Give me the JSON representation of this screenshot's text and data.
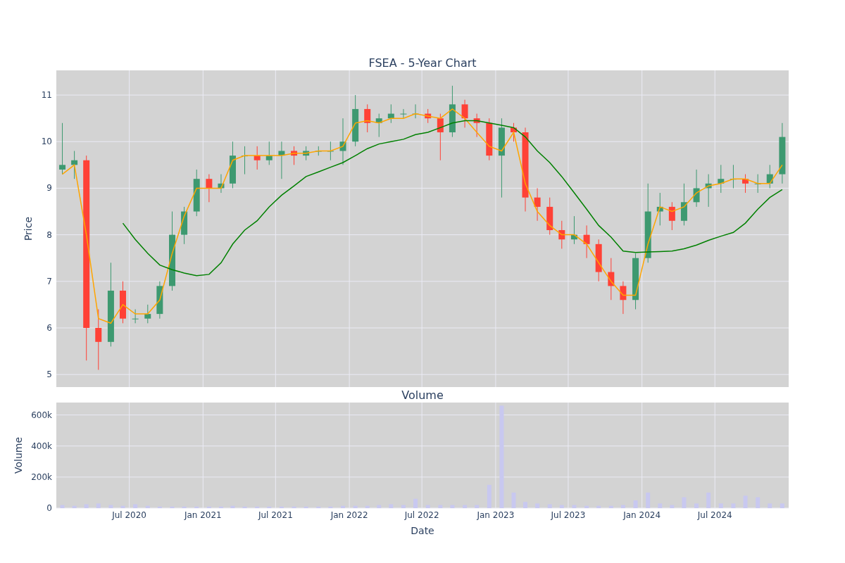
{
  "price_chart": {
    "chart_data": {
      "type": "candlestick",
      "title": "FSEA - 5-Year Chart",
      "grid": true,
      "ohlc": [
        [
          9.4,
          10.4,
          9.3,
          9.5
        ],
        [
          9.5,
          9.8,
          9.2,
          9.6
        ],
        [
          9.6,
          9.7,
          5.3,
          6.0
        ],
        [
          6.0,
          6.4,
          5.1,
          5.7
        ],
        [
          5.7,
          7.4,
          5.6,
          6.8
        ],
        [
          6.8,
          7.0,
          6.1,
          6.2
        ],
        [
          6.2,
          6.4,
          6.1,
          6.2
        ],
        [
          6.2,
          6.5,
          6.1,
          6.3
        ],
        [
          6.3,
          7.0,
          6.2,
          6.9
        ],
        [
          6.9,
          8.5,
          6.8,
          8.0
        ],
        [
          8.0,
          8.6,
          7.8,
          8.5
        ],
        [
          8.5,
          9.4,
          8.4,
          9.2
        ],
        [
          9.2,
          9.3,
          8.7,
          9.0
        ],
        [
          9.0,
          9.3,
          8.9,
          9.1
        ],
        [
          9.1,
          10.0,
          9.0,
          9.7
        ],
        [
          9.7,
          9.9,
          9.3,
          9.7
        ],
        [
          9.7,
          9.9,
          9.4,
          9.6
        ],
        [
          9.6,
          10.0,
          9.5,
          9.7
        ],
        [
          9.7,
          10.0,
          9.2,
          9.8
        ],
        [
          9.8,
          9.9,
          9.5,
          9.7
        ],
        [
          9.7,
          9.9,
          9.6,
          9.8
        ],
        [
          9.8,
          9.9,
          9.7,
          9.8
        ],
        [
          9.8,
          10.0,
          9.6,
          9.8
        ],
        [
          9.8,
          10.5,
          9.5,
          10.0
        ],
        [
          10.0,
          11.0,
          9.9,
          10.7
        ],
        [
          10.7,
          10.8,
          10.2,
          10.4
        ],
        [
          10.4,
          10.6,
          10.1,
          10.5
        ],
        [
          10.5,
          10.8,
          10.4,
          10.6
        ],
        [
          10.6,
          10.7,
          10.5,
          10.6
        ],
        [
          10.6,
          10.8,
          10.5,
          10.6
        ],
        [
          10.6,
          10.7,
          10.4,
          10.5
        ],
        [
          10.5,
          10.6,
          9.6,
          10.2
        ],
        [
          10.2,
          11.2,
          10.1,
          10.8
        ],
        [
          10.8,
          10.9,
          10.3,
          10.5
        ],
        [
          10.5,
          10.6,
          10.1,
          10.4
        ],
        [
          10.4,
          10.5,
          9.6,
          9.7
        ],
        [
          9.7,
          10.5,
          8.8,
          10.3
        ],
        [
          10.3,
          10.4,
          10.0,
          10.2
        ],
        [
          10.2,
          10.3,
          8.5,
          8.8
        ],
        [
          8.8,
          9.0,
          8.3,
          8.6
        ],
        [
          8.6,
          8.8,
          8.0,
          8.1
        ],
        [
          8.1,
          8.3,
          7.7,
          7.9
        ],
        [
          7.9,
          8.4,
          7.8,
          8.0
        ],
        [
          8.0,
          8.2,
          7.5,
          7.8
        ],
        [
          7.8,
          7.9,
          7.0,
          7.2
        ],
        [
          7.2,
          7.5,
          6.6,
          6.9
        ],
        [
          6.9,
          7.0,
          6.3,
          6.6
        ],
        [
          6.6,
          7.6,
          6.4,
          7.5
        ],
        [
          7.5,
          9.1,
          7.4,
          8.5
        ],
        [
          8.5,
          8.9,
          8.2,
          8.6
        ],
        [
          8.6,
          8.7,
          8.1,
          8.3
        ],
        [
          8.3,
          9.1,
          8.2,
          8.7
        ],
        [
          8.7,
          9.4,
          8.6,
          9.0
        ],
        [
          9.0,
          9.3,
          8.6,
          9.1
        ],
        [
          9.1,
          9.5,
          8.9,
          9.2
        ],
        [
          9.2,
          9.5,
          9.0,
          9.2
        ],
        [
          9.2,
          9.3,
          8.9,
          9.1
        ],
        [
          9.1,
          9.3,
          8.9,
          9.1
        ],
        [
          9.1,
          9.5,
          9.0,
          9.3
        ],
        [
          9.3,
          10.4,
          9.1,
          10.1
        ]
      ],
      "ylabel": "Price",
      "ylim": [
        4.73,
        11.53
      ],
      "xlim": [
        "2020-01-01",
        "2025-01-01"
      ],
      "yticks": [
        {
          "value": 5,
          "label": "5"
        },
        {
          "value": 6,
          "label": "6"
        },
        {
          "value": 7,
          "label": "7"
        },
        {
          "value": 8,
          "label": "8"
        },
        {
          "value": 9,
          "label": "9"
        },
        {
          "value": 10,
          "label": "10"
        },
        {
          "value": 11,
          "label": "11"
        }
      ],
      "x": [
        "2020-01-16",
        "2020-02-15",
        "2020-03-16",
        "2020-04-15",
        "2020-05-16",
        "2020-06-15",
        "2020-07-16",
        "2020-08-16",
        "2020-09-15",
        "2020-10-16",
        "2020-11-15",
        "2020-12-16",
        "2021-01-16",
        "2021-02-15",
        "2021-03-16",
        "2021-04-15",
        "2021-05-16",
        "2021-06-15",
        "2021-07-16",
        "2021-08-16",
        "2021-09-15",
        "2021-10-16",
        "2021-11-15",
        "2021-12-16",
        "2022-01-16",
        "2022-02-15",
        "2022-03-16",
        "2022-04-15",
        "2022-05-16",
        "2022-06-15",
        "2022-07-16",
        "2022-08-16",
        "2022-09-15",
        "2022-10-16",
        "2022-11-15",
        "2022-12-16",
        "2023-01-16",
        "2023-02-15",
        "2023-03-16",
        "2023-04-15",
        "2023-05-16",
        "2023-06-15",
        "2023-07-16",
        "2023-08-16",
        "2023-09-15",
        "2023-10-16",
        "2023-11-15",
        "2023-12-16",
        "2024-01-16",
        "2024-02-15",
        "2024-03-16",
        "2024-04-15",
        "2024-05-16",
        "2024-06-15",
        "2024-07-16",
        "2024-08-16",
        "2024-09-15",
        "2024-10-16",
        "2024-11-15",
        "2024-12-16"
      ],
      "series": [
        {
          "type": "line",
          "color": "#ffa500",
          "values": [
            9.3,
            9.5,
            8.0,
            6.2,
            6.1,
            6.5,
            6.3,
            6.3,
            6.6,
            7.6,
            8.4,
            9.0,
            9.0,
            9.0,
            9.6,
            9.7,
            9.7,
            9.7,
            9.7,
            9.75,
            9.75,
            9.8,
            9.8,
            9.9,
            10.4,
            10.45,
            10.4,
            10.5,
            10.5,
            10.6,
            10.55,
            10.5,
            10.7,
            10.5,
            10.2,
            9.9,
            9.8,
            10.2,
            9.1,
            8.5,
            8.2,
            8.0,
            8.0,
            7.8,
            7.4,
            7.0,
            6.7,
            6.7,
            7.8,
            8.6,
            8.5,
            8.6,
            8.9,
            9.05,
            9.1,
            9.2,
            9.2,
            9.1,
            9.1,
            9.5
          ]
        },
        {
          "type": "line",
          "color": "#008000",
          "values": [
            null,
            null,
            null,
            null,
            null,
            8.25,
            7.9,
            7.6,
            7.35,
            7.25,
            7.18,
            7.12,
            7.15,
            7.4,
            7.8,
            8.1,
            8.3,
            8.6,
            8.85,
            9.05,
            9.25,
            9.35,
            9.45,
            9.55,
            9.7,
            9.85,
            9.95,
            10.0,
            10.05,
            10.15,
            10.2,
            10.3,
            10.4,
            10.45,
            10.45,
            10.4,
            10.35,
            10.3,
            10.1,
            9.8,
            9.55,
            9.25,
            8.9,
            8.55,
            8.2,
            7.95,
            7.65,
            7.62,
            7.63,
            7.64,
            7.65,
            7.7,
            7.78,
            7.88,
            7.97,
            8.05,
            8.25,
            8.55,
            8.8,
            8.97
          ]
        }
      ]
    }
  },
  "volume_chart": {
    "chart_data": {
      "type": "bar",
      "title": "Volume",
      "grid": true,
      "xlabel": "Date",
      "ylabel": "Volume",
      "ylim": [
        0,
        680000
      ],
      "xlim": [
        "2020-01-01",
        "2025-01-01"
      ],
      "yticks": [
        {
          "value": 0,
          "label": "0"
        },
        {
          "value": 200000,
          "label": "200k"
        },
        {
          "value": 400000,
          "label": "400k"
        },
        {
          "value": 600000,
          "label": "600k"
        }
      ],
      "xticks": [
        {
          "value": "2020-07-01",
          "label": "Jul 2020"
        },
        {
          "value": "2021-01-01",
          "label": "Jan 2021"
        },
        {
          "value": "2021-07-01",
          "label": "Jul 2021"
        },
        {
          "value": "2022-01-01",
          "label": "Jan 2022"
        },
        {
          "value": "2022-07-01",
          "label": "Jul 2022"
        },
        {
          "value": "2023-01-01",
          "label": "Jan 2023"
        },
        {
          "value": "2023-07-01",
          "label": "Jul 2023"
        },
        {
          "value": "2024-01-01",
          "label": "Jan 2024"
        },
        {
          "value": "2024-07-01",
          "label": "Jul 2024"
        }
      ],
      "x": [
        "2020-01-16",
        "2020-02-15",
        "2020-03-16",
        "2020-04-15",
        "2020-05-16",
        "2020-06-15",
        "2020-07-16",
        "2020-08-16",
        "2020-09-15",
        "2020-10-16",
        "2020-11-15",
        "2020-12-16",
        "2021-01-16",
        "2021-02-15",
        "2021-03-16",
        "2021-04-15",
        "2021-05-16",
        "2021-06-15",
        "2021-07-16",
        "2021-08-16",
        "2021-09-15",
        "2021-10-16",
        "2021-11-15",
        "2021-12-16",
        "2022-01-16",
        "2022-02-15",
        "2022-03-16",
        "2022-04-15",
        "2022-05-16",
        "2022-06-15",
        "2022-07-16",
        "2022-08-16",
        "2022-09-15",
        "2022-10-16",
        "2022-11-15",
        "2022-12-16",
        "2023-01-16",
        "2023-02-15",
        "2023-03-16",
        "2023-04-15",
        "2023-05-16",
        "2023-06-15",
        "2023-07-16",
        "2023-08-16",
        "2023-09-15",
        "2023-10-16",
        "2023-11-15",
        "2023-12-16",
        "2024-01-16",
        "2024-02-15",
        "2024-03-16",
        "2024-04-15",
        "2024-05-16",
        "2024-06-15",
        "2024-07-16",
        "2024-08-16",
        "2024-09-15",
        "2024-10-16",
        "2024-11-15",
        "2024-12-16"
      ],
      "series": [
        {
          "color": "#c8c8f0",
          "values": [
            20000,
            15000,
            25000,
            30000,
            20000,
            15000,
            25000,
            15000,
            10000,
            10000,
            10000,
            10000,
            10000,
            10000,
            15000,
            10000,
            10000,
            10000,
            10000,
            10000,
            10000,
            10000,
            10000,
            15000,
            15000,
            15000,
            20000,
            25000,
            20000,
            60000,
            20000,
            20000,
            20000,
            20000,
            20000,
            150000,
            660000,
            100000,
            40000,
            30000,
            25000,
            20000,
            20000,
            15000,
            15000,
            15000,
            20000,
            50000,
            100000,
            30000,
            20000,
            70000,
            30000,
            100000,
            30000,
            30000,
            80000,
            70000,
            30000,
            30000
          ]
        }
      ]
    }
  }
}
